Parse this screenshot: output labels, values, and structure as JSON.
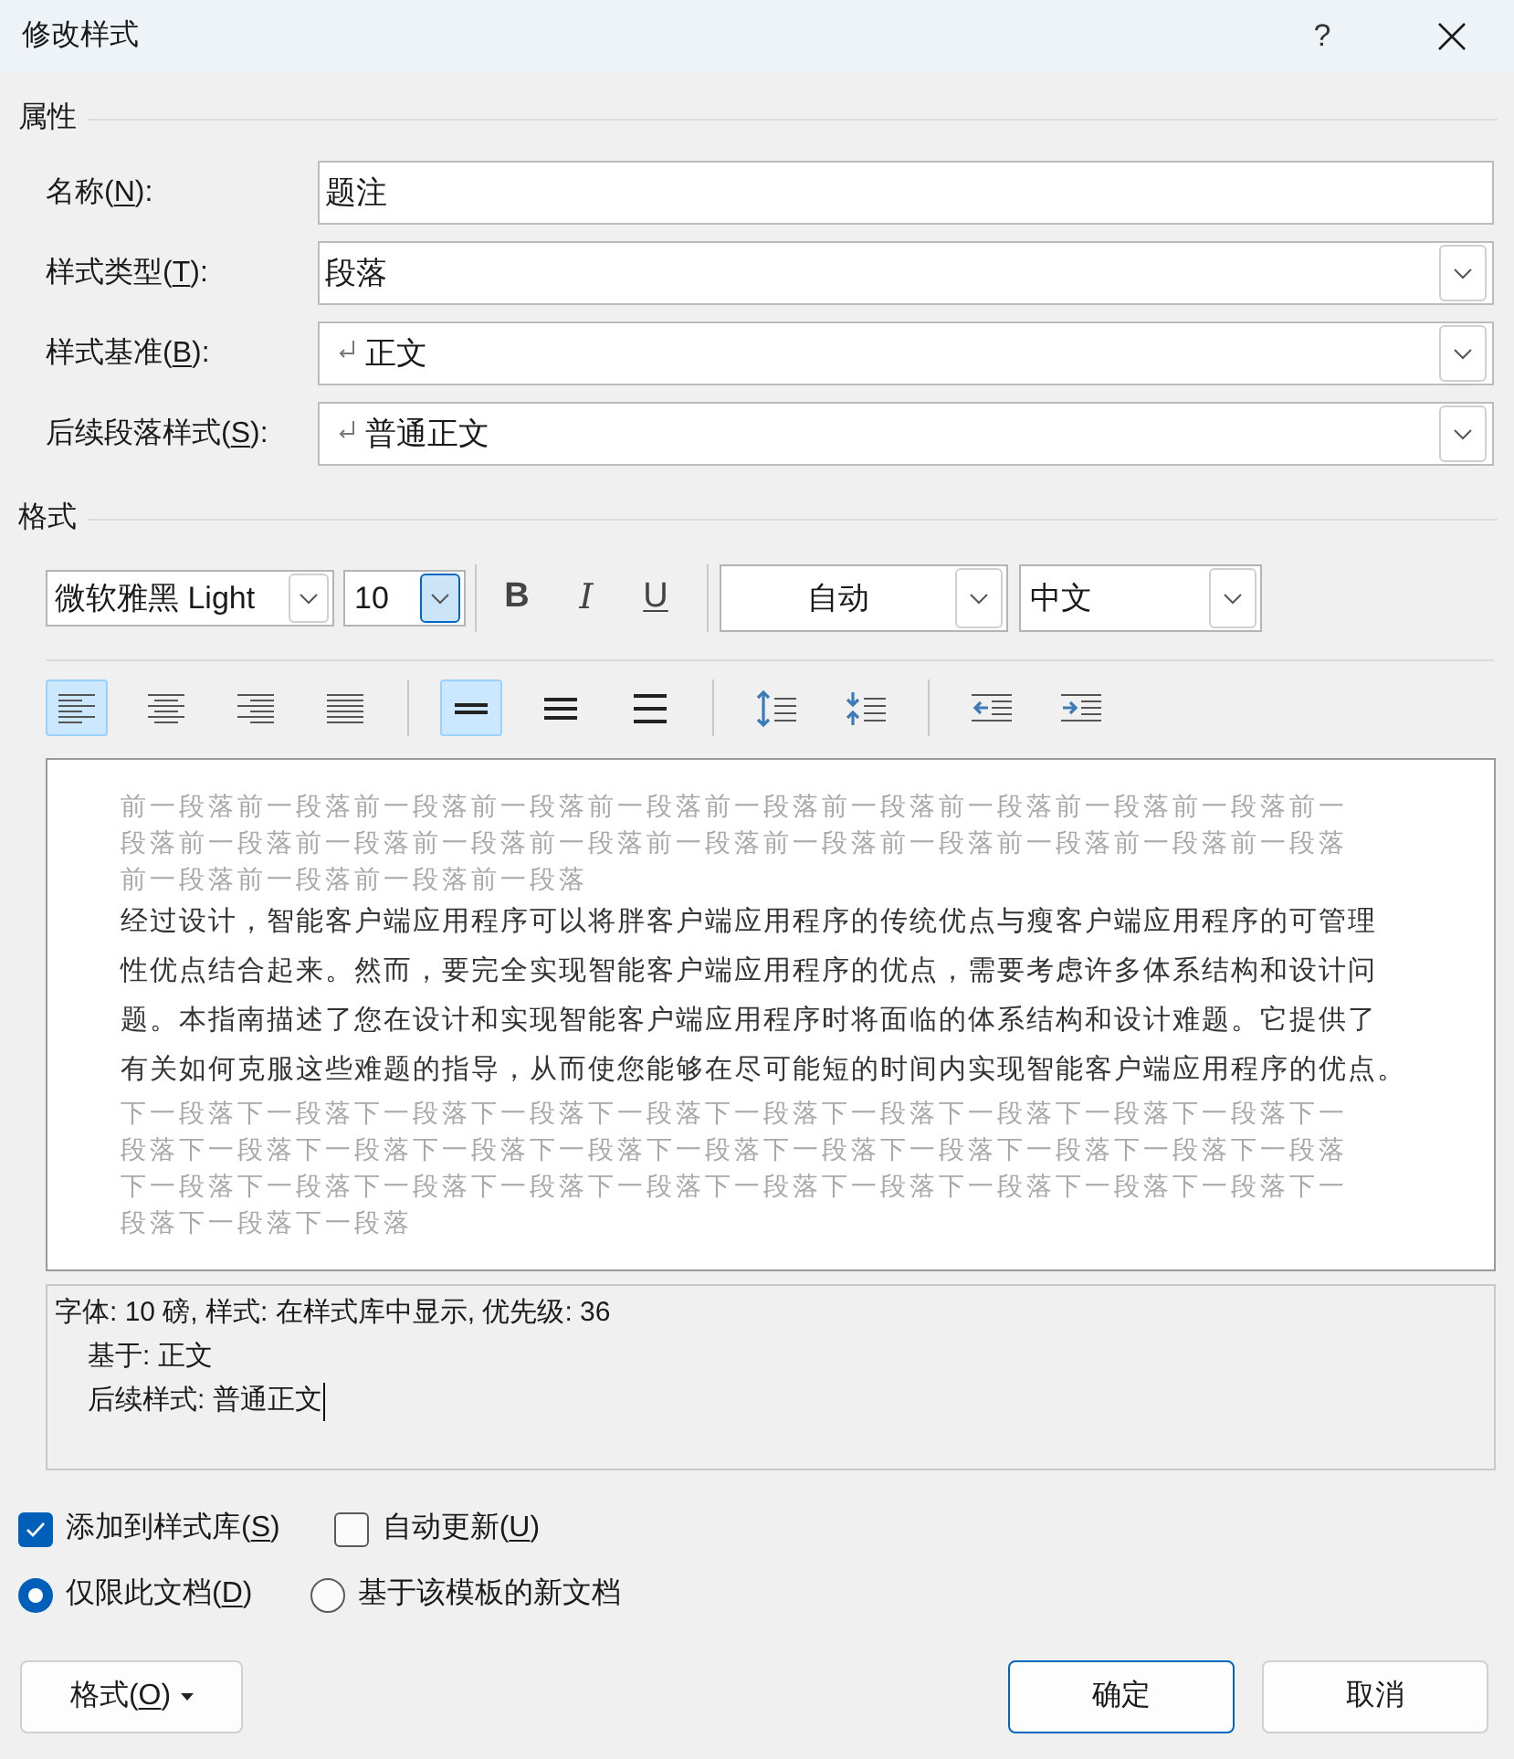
{
  "window": {
    "title": "修改样式",
    "help_label": "?"
  },
  "properties": {
    "heading": "属性",
    "fields": [
      {
        "label": [
          "名称(",
          "N",
          "):"
        ],
        "kind": "text",
        "value": "题注",
        "paragraph_mark": false
      },
      {
        "label": [
          "样式类型(",
          "T",
          "):"
        ],
        "kind": "dropdown",
        "value": "段落",
        "paragraph_mark": false
      },
      {
        "label": [
          "样式基准(",
          "B",
          "):"
        ],
        "kind": "dropdown",
        "value": "正文",
        "paragraph_mark": true
      },
      {
        "label": [
          "后续段落样式(",
          "S",
          "):"
        ],
        "kind": "dropdown",
        "value": "普通正文",
        "paragraph_mark": true
      }
    ]
  },
  "format": {
    "heading": "格式",
    "font": {
      "value": "微软雅黑 Light",
      "focused": false
    },
    "size": {
      "value": "10",
      "focused": true
    },
    "style_buttons": [
      {
        "kind": "bold",
        "label": "B",
        "selected": false
      },
      {
        "kind": "italic",
        "label": "I",
        "selected": false
      },
      {
        "kind": "underline",
        "label": "U",
        "selected": false
      }
    ],
    "color": {
      "value": "自动"
    },
    "language": {
      "value": "中文"
    },
    "paragraph_groups": [
      {
        "buttons": [
          {
            "kind": "align-left",
            "selected": true
          },
          {
            "kind": "align-center",
            "selected": false
          },
          {
            "kind": "align-right",
            "selected": false
          },
          {
            "kind": "justify",
            "selected": false
          }
        ]
      },
      {
        "buttons": [
          {
            "kind": "single-spacing",
            "selected": true
          },
          {
            "kind": "one-half-spacing",
            "selected": false
          },
          {
            "kind": "double-spacing",
            "selected": false
          }
        ]
      },
      {
        "buttons": [
          {
            "kind": "increase-paragraph-spacing"
          },
          {
            "kind": "decrease-paragraph-spacing"
          }
        ]
      },
      {
        "buttons": [
          {
            "kind": "decrease-indent"
          },
          {
            "kind": "increase-indent"
          }
        ]
      }
    ]
  },
  "preview": {
    "paragraphs": [
      {
        "kind": "context",
        "lines": [
          "前一段落前一段落前一段落前一段落前一段落前一段落前一段落前一段落前一段落前一段落前一",
          "段落前一段落前一段落前一段落前一段落前一段落前一段落前一段落前一段落前一段落前一段落",
          "前一段落前一段落前一段落前一段落"
        ]
      },
      {
        "kind": "sample",
        "lines": [
          "经过设计，智能客户端应用程序可以将胖客户端应用程序的传统优点与瘦客户端应用程序的可管理",
          "性优点结合起来。然而，要完全实现智能客户端应用程序的优点，需要考虑许多体系结构和设计问",
          "题。本指南描述了您在设计和实现智能客户端应用程序时将面临的体系结构和设计难题。它提供了",
          "有关如何克服这些难题的指导，从而使您能够在尽可能短的时间内实现智能客户端应用程序的优点。"
        ]
      },
      {
        "kind": "context",
        "lines": [
          "下一段落下一段落下一段落下一段落下一段落下一段落下一段落下一段落下一段落下一段落下一",
          "段落下一段落下一段落下一段落下一段落下一段落下一段落下一段落下一段落下一段落下一段落",
          "下一段落下一段落下一段落下一段落下一段落下一段落下一段落下一段落下一段落下一段落下一",
          "段落下一段落下一段落"
        ]
      }
    ]
  },
  "description": {
    "text": "字体: 10 磅, 样式: 在样式库中显示, 优先级: 36",
    "children": [
      {
        "text": "基于: 正文"
      },
      {
        "text": "后续样式: 普通正文"
      }
    ],
    "focused": true
  },
  "options": {
    "checkboxes": [
      {
        "label": [
          "添加到样式库(",
          "S",
          ")"
        ],
        "checked": true
      },
      {
        "label": [
          "自动更新(",
          "U",
          ")"
        ],
        "checked": false
      }
    ],
    "radios": [
      {
        "label": [
          "仅限此文档(",
          "D",
          ")"
        ],
        "selected": true
      },
      {
        "label": [
          "基于该模板的新文档"
        ],
        "selected": false
      }
    ]
  },
  "buttons": [
    {
      "kind": "menu",
      "label": [
        "格式(",
        "O",
        ")"
      ]
    },
    {
      "kind": "default",
      "label": [
        "确定"
      ]
    },
    {
      "kind": "normal",
      "label": [
        "取消"
      ]
    }
  ]
}
